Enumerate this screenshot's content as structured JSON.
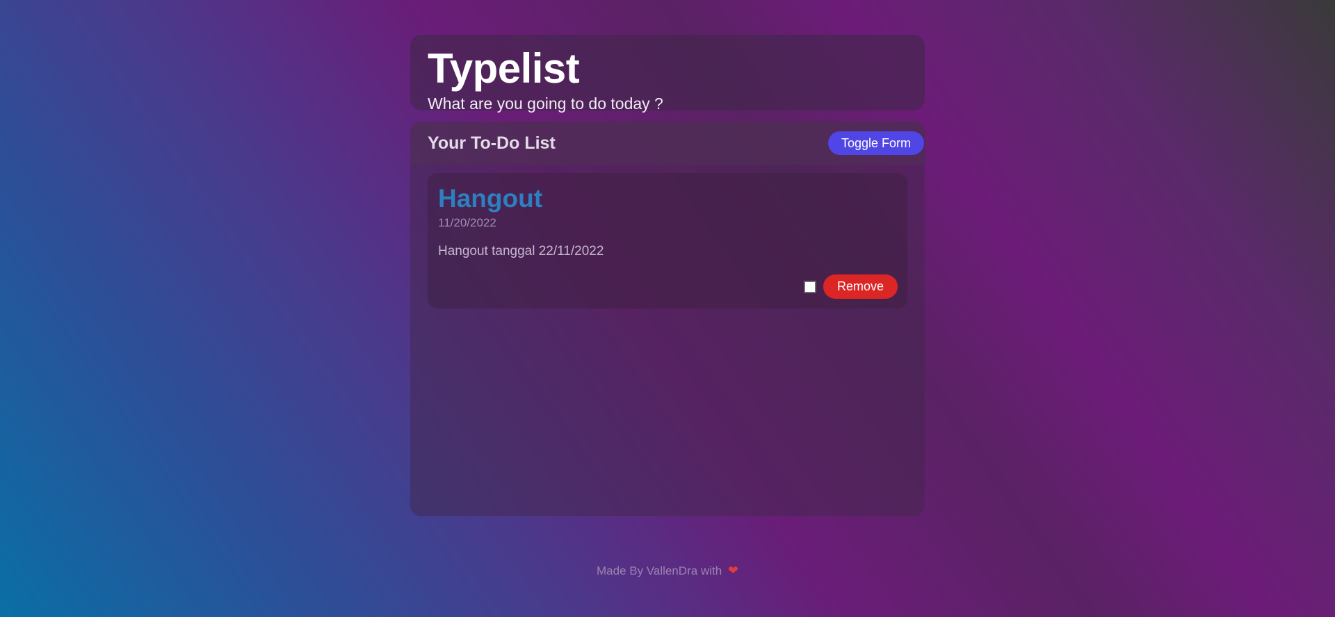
{
  "header": {
    "title": "Typelist",
    "subtitle": "What are you going to do today ?"
  },
  "list": {
    "title": "Your To-Do List",
    "toggle_label": "Toggle Form",
    "items": [
      {
        "title": "Hangout",
        "date": "11/20/2022",
        "description": "Hangout tanggal 22/11/2022",
        "checked": false,
        "remove_label": "Remove"
      }
    ]
  },
  "footer": {
    "text": "Made By VallenDra with",
    "icon": "heart-icon",
    "icon_glyph": "❤"
  },
  "colors": {
    "toggle_button": "#4f46e5",
    "remove_button": "#dc2626",
    "item_title": "#2d7fc0",
    "heart": "#e23b3b"
  }
}
